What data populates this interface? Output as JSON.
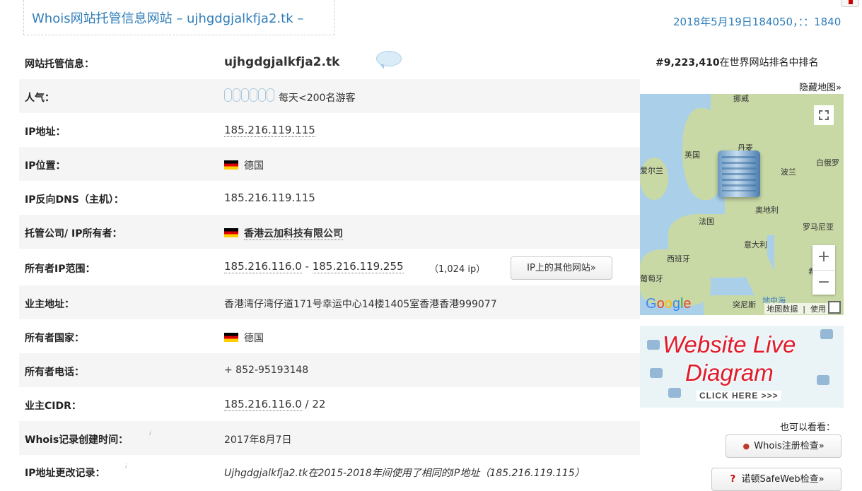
{
  "header": {
    "title": "Whois网站托管信息网站 – ujhgdgjalkfja2.tk –",
    "date": "2018年5月19日184050，：：1840"
  },
  "rank": {
    "value": "#9,223,410",
    "suffix": "在世界网站排名中排名"
  },
  "hide_map": "隐藏地图»",
  "rows": [
    {
      "label": "网站托管信息：",
      "value": "ujhgdgjalkfja2.tk"
    },
    {
      "label": "人气：",
      "value": "每天<200名游客"
    },
    {
      "label": "IP地址：",
      "value": "185.216.119.115"
    },
    {
      "label": "IP位置：",
      "value": "德国"
    },
    {
      "label": "IP反向DNS（主机）：",
      "value": "185.216.119.115"
    },
    {
      "label": "托管公司/ IP所有者：",
      "value": "香港云加科技有限公司"
    },
    {
      "label": "所有者IP范围：",
      "range_start": "185.216.116.0",
      "range_sep": " - ",
      "range_end": "185.216.119.255",
      "count": "（1,024 ip）"
    },
    {
      "label": "业主地址：",
      "value": "香港湾仔湾仔道171号幸运中心14楼1405室香港香港999077"
    },
    {
      "label": "所有者国家：",
      "value": "德国"
    },
    {
      "label": "所有者电话：",
      "value": "+ 852-95193148"
    },
    {
      "label": "业主CIDR：",
      "cidr_ip": "185.216.116.0",
      "cidr_suffix": " / 22"
    },
    {
      "label": "Whois记录创建时间：",
      "value": "2017年8月7日"
    },
    {
      "label": "IP地址更改记录：",
      "value": "Ujhgdgjalkfja2.tk在2015-2018年间使用了相同的IP地址（185.216.119.115）"
    }
  ],
  "buttons": {
    "ip_sites": "IP上的其他网站»",
    "whois_check": "Whois注册检查»",
    "norton_check": "诺顿SafeWeb检查»"
  },
  "also_see": "也可以看看：",
  "map": {
    "labels": [
      "挪威",
      "丹麦",
      "英国",
      "爱尔兰",
      "波兰",
      "白俄罗",
      "奥地利",
      "法国",
      "罗马尼亚",
      "意大利",
      "西班牙",
      "葡萄牙",
      "希",
      "突尼斯",
      "地中海"
    ],
    "attribution_data": "地图数据",
    "attribution_use": "使用",
    "zoom_in": "+",
    "zoom_out": "−"
  },
  "live_diagram": {
    "line1": "Website Live",
    "line2": "Diagram",
    "line3": "CLICK HERE >>>"
  },
  "colors": {
    "link_blue": "#2f7db8",
    "row_alt": "#f5f5f5",
    "flag_black": "#000000",
    "flag_red": "#dd0000",
    "flag_gold": "#ffce00"
  }
}
